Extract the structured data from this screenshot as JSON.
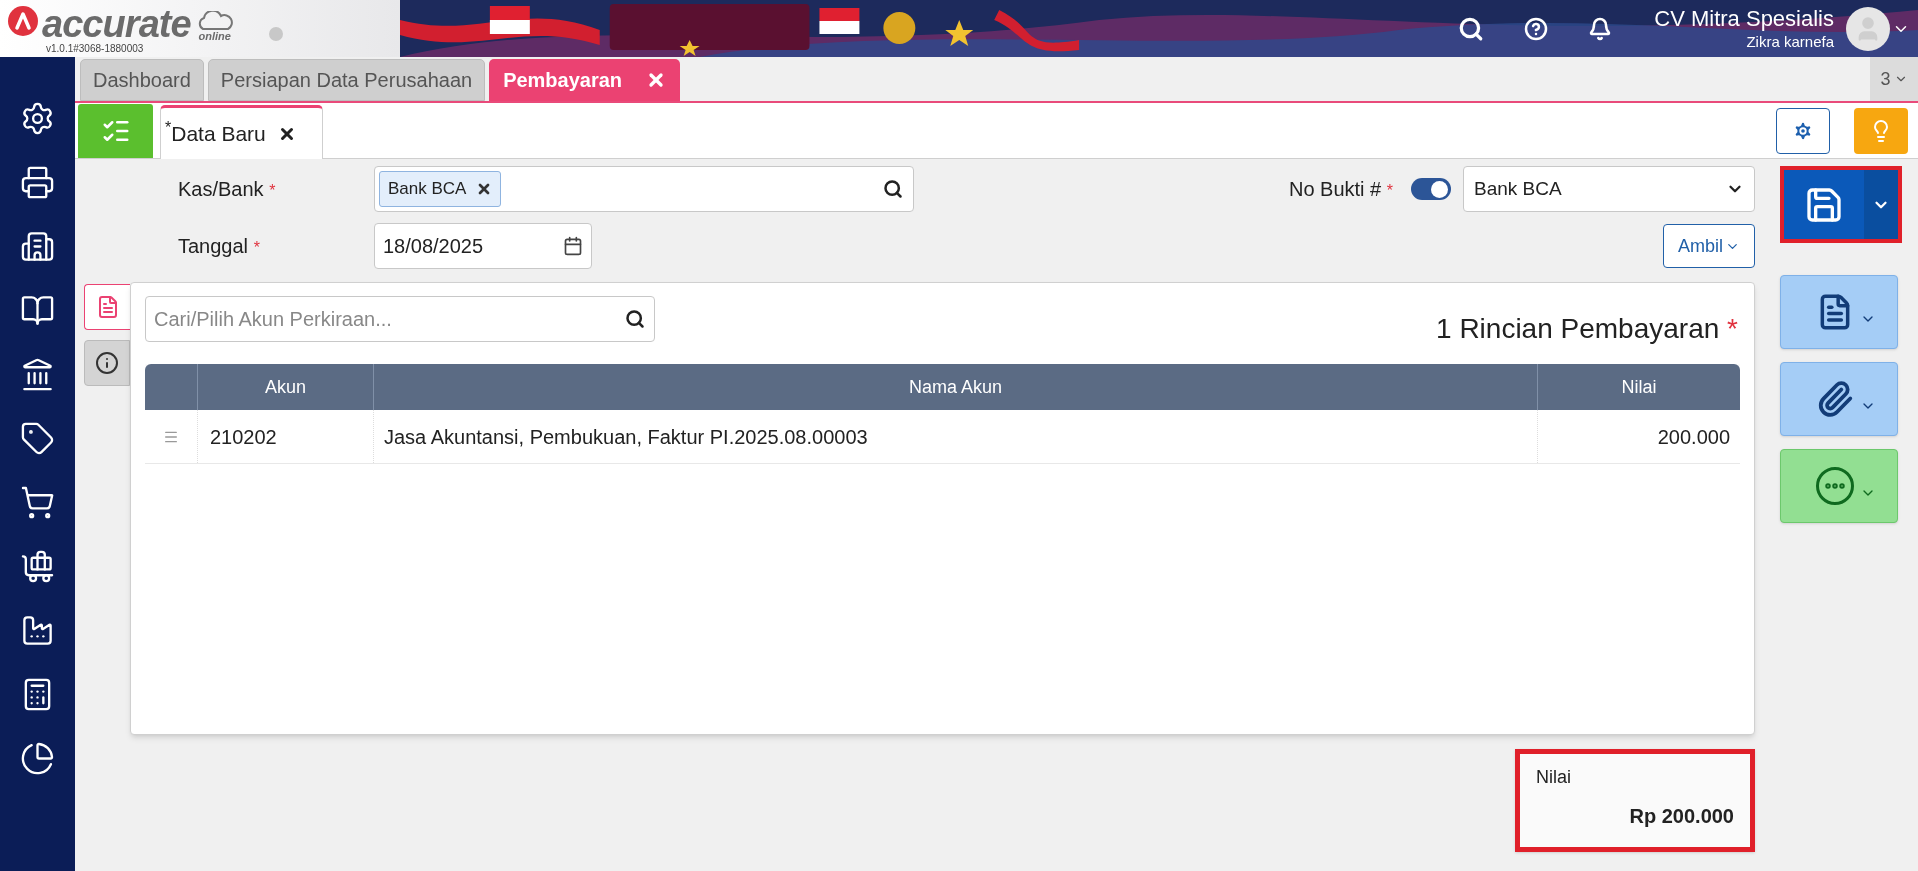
{
  "header": {
    "logo_word": "accurate",
    "logo_sub": "online",
    "version": "v1.0.1#3068-1880003",
    "company": "CV Mitra Spesialis",
    "user": "Zikra karnefa"
  },
  "tabs": [
    {
      "label": "Dashboard",
      "selected": false,
      "closable": false
    },
    {
      "label": "Persiapan Data Perusahaan",
      "selected": false,
      "closable": false
    },
    {
      "label": "Pembayaran",
      "selected": true,
      "closable": true
    }
  ],
  "tab_count": "3",
  "sidebar": {
    "items": [
      {
        "kind": "settings"
      },
      {
        "kind": "printer"
      },
      {
        "kind": "building"
      },
      {
        "kind": "book"
      },
      {
        "kind": "bank"
      },
      {
        "kind": "tag"
      },
      {
        "kind": "cart"
      },
      {
        "kind": "trolley"
      },
      {
        "kind": "factory"
      },
      {
        "kind": "calculator"
      },
      {
        "kind": "report"
      }
    ]
  },
  "subtabs": [
    {
      "label": "Data Baru",
      "modified_mark": "*",
      "selected": true
    }
  ],
  "form": {
    "kas_bank": {
      "label": "Kas/Bank",
      "mark": "*",
      "tag": "Bank BCA"
    },
    "tanggal": {
      "label": "Tanggal",
      "mark": "*",
      "value": "18/08/2025"
    },
    "no_bukti": {
      "label": "No Bukti #",
      "mark": "*",
      "auto": true,
      "value": "Bank BCA"
    },
    "ambil": "Ambil"
  },
  "detail": {
    "side_tabs": [
      {
        "kind": "document",
        "selected": true
      },
      {
        "kind": "info",
        "selected": false
      }
    ],
    "search": {
      "placeholder": "Cari/Pilih Akun Perkiraan..."
    },
    "title": "1 Rincian Pembayaran",
    "title_mark": "*",
    "columns": [
      "Akun",
      "Nama Akun",
      "Nilai"
    ],
    "rows": [
      {
        "akun": "210202",
        "nama": "Jasa Akuntansi, Pembukuan, Faktur PI.2025.08.00003",
        "nilai": "200.000"
      }
    ]
  },
  "summary": {
    "label": "Nilai",
    "value": "Rp 200.000"
  }
}
